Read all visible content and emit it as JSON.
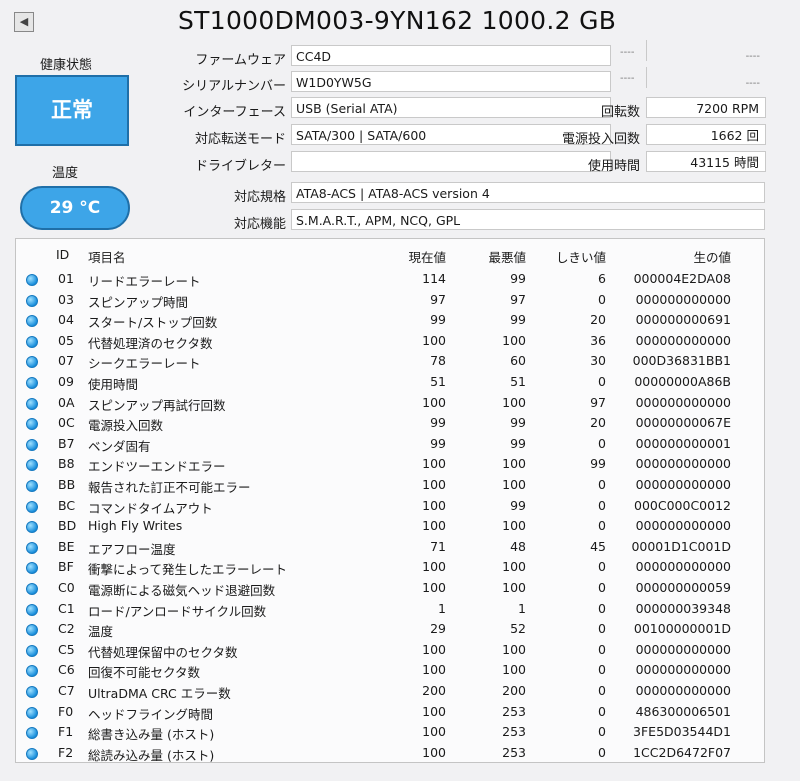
{
  "disk": {
    "title": "ST1000DM003-9YN162 1000.2 GB"
  },
  "health": {
    "label": "健康状態",
    "status": "正常"
  },
  "temperature": {
    "label": "温度",
    "value": "29 °C"
  },
  "info": {
    "firmware_label": "ファームウェア",
    "firmware": "CC4D",
    "serial_label": "シリアルナンバー",
    "serial": "W1D0YW5G",
    "interface_label": "インターフェース",
    "interface": "USB (Serial ATA)",
    "transfer_label": "対応転送モード",
    "transfer": "SATA/300 | SATA/600",
    "drive_letter_label": "ドライブレター",
    "drive_letter": "",
    "standard_label": "対応規格",
    "standard": "ATA8-ACS | ATA8-ACS version 4",
    "features_label": "対応機能",
    "features": "S.M.A.R.T., APM, NCQ, GPL",
    "rotation_label": "回転数",
    "rotation": "7200 RPM",
    "power_count_label": "電源投入回数",
    "power_count": "1662 回",
    "power_hours_label": "使用時間",
    "power_hours": "43115 時間",
    "dash": "----"
  },
  "smart": {
    "headers": {
      "id": "ID",
      "name": "項目名",
      "current": "現在値",
      "worst": "最悪値",
      "threshold": "しきい値",
      "raw": "生の値"
    },
    "rows": [
      {
        "id": "01",
        "name": "リードエラーレート",
        "current": "114",
        "worst": "99",
        "threshold": "6",
        "raw": "000004E2DA08"
      },
      {
        "id": "03",
        "name": "スピンアップ時間",
        "current": "97",
        "worst": "97",
        "threshold": "0",
        "raw": "000000000000"
      },
      {
        "id": "04",
        "name": "スタート/ストップ回数",
        "current": "99",
        "worst": "99",
        "threshold": "20",
        "raw": "000000000691"
      },
      {
        "id": "05",
        "name": "代替処理済のセクタ数",
        "current": "100",
        "worst": "100",
        "threshold": "36",
        "raw": "000000000000"
      },
      {
        "id": "07",
        "name": "シークエラーレート",
        "current": "78",
        "worst": "60",
        "threshold": "30",
        "raw": "000D36831BB1"
      },
      {
        "id": "09",
        "name": "使用時間",
        "current": "51",
        "worst": "51",
        "threshold": "0",
        "raw": "00000000A86B"
      },
      {
        "id": "0A",
        "name": "スピンアップ再試行回数",
        "current": "100",
        "worst": "100",
        "threshold": "97",
        "raw": "000000000000"
      },
      {
        "id": "0C",
        "name": "電源投入回数",
        "current": "99",
        "worst": "99",
        "threshold": "20",
        "raw": "00000000067E"
      },
      {
        "id": "B7",
        "name": "ベンダ固有",
        "current": "99",
        "worst": "99",
        "threshold": "0",
        "raw": "000000000001"
      },
      {
        "id": "B8",
        "name": "エンドツーエンドエラー",
        "current": "100",
        "worst": "100",
        "threshold": "99",
        "raw": "000000000000"
      },
      {
        "id": "BB",
        "name": "報告された訂正不可能エラー",
        "current": "100",
        "worst": "100",
        "threshold": "0",
        "raw": "000000000000"
      },
      {
        "id": "BC",
        "name": "コマンドタイムアウト",
        "current": "100",
        "worst": "99",
        "threshold": "0",
        "raw": "000C000C0012"
      },
      {
        "id": "BD",
        "name": "High Fly Writes",
        "current": "100",
        "worst": "100",
        "threshold": "0",
        "raw": "000000000000"
      },
      {
        "id": "BE",
        "name": "エアフロー温度",
        "current": "71",
        "worst": "48",
        "threshold": "45",
        "raw": "00001D1C001D"
      },
      {
        "id": "BF",
        "name": "衝撃によって発生したエラーレート",
        "current": "100",
        "worst": "100",
        "threshold": "0",
        "raw": "000000000000"
      },
      {
        "id": "C0",
        "name": "電源断による磁気ヘッド退避回数",
        "current": "100",
        "worst": "100",
        "threshold": "0",
        "raw": "000000000059"
      },
      {
        "id": "C1",
        "name": "ロード/アンロードサイクル回数",
        "current": "1",
        "worst": "1",
        "threshold": "0",
        "raw": "000000039348"
      },
      {
        "id": "C2",
        "name": "温度",
        "current": "29",
        "worst": "52",
        "threshold": "0",
        "raw": "00100000001D"
      },
      {
        "id": "C5",
        "name": "代替処理保留中のセクタ数",
        "current": "100",
        "worst": "100",
        "threshold": "0",
        "raw": "000000000000"
      },
      {
        "id": "C6",
        "name": "回復不可能セクタ数",
        "current": "100",
        "worst": "100",
        "threshold": "0",
        "raw": "000000000000"
      },
      {
        "id": "C7",
        "name": "UltraDMA CRC エラー数",
        "current": "200",
        "worst": "200",
        "threshold": "0",
        "raw": "000000000000"
      },
      {
        "id": "F0",
        "name": "ヘッドフライング時間",
        "current": "100",
        "worst": "253",
        "threshold": "0",
        "raw": "486300006501"
      },
      {
        "id": "F1",
        "name": "総書き込み量 (ホスト)",
        "current": "100",
        "worst": "253",
        "threshold": "0",
        "raw": "3FE5D03544D1"
      },
      {
        "id": "F2",
        "name": "総読み込み量 (ホスト)",
        "current": "100",
        "worst": "253",
        "threshold": "0",
        "raw": "1CC2D6472F07"
      }
    ]
  }
}
